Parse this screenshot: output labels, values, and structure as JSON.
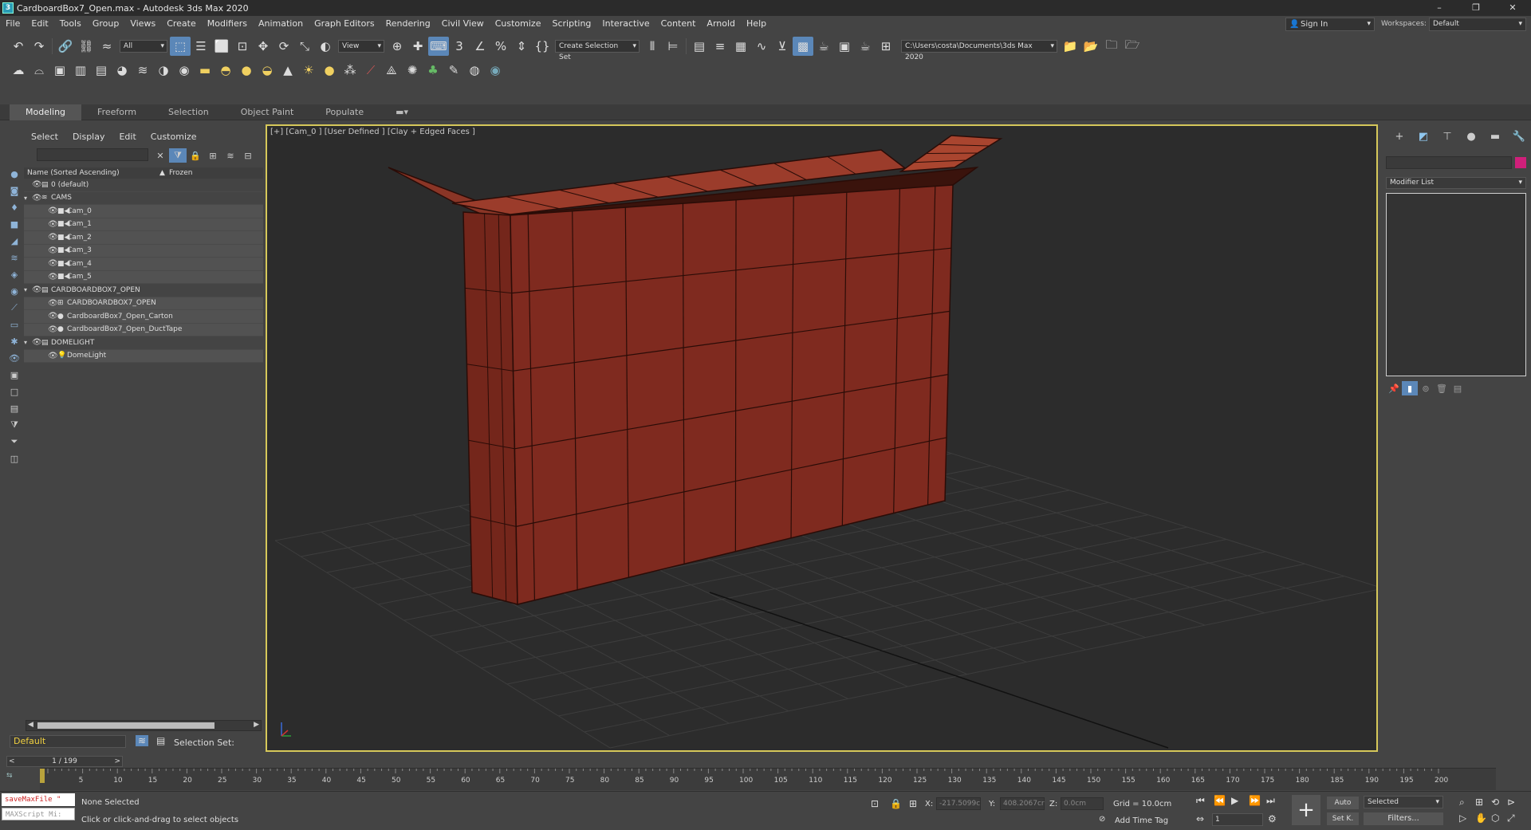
{
  "window": {
    "title": "CardboardBox7_Open.max - Autodesk 3ds Max 2020",
    "icon_letter": "3",
    "minimize": "–",
    "restore": "❐",
    "close": "✕"
  },
  "menu": [
    "File",
    "Edit",
    "Tools",
    "Group",
    "Views",
    "Create",
    "Modifiers",
    "Animation",
    "Graph Editors",
    "Rendering",
    "Civil View",
    "Customize",
    "Scripting",
    "Interactive",
    "Content",
    "Arnold",
    "Help"
  ],
  "account": {
    "sign_in": "Sign In",
    "workspaces_label": "Workspaces:",
    "workspace": "Default"
  },
  "toolbar": {
    "selection_filter": "All",
    "ref_coord": "View",
    "named_selection": "Create Selection Set",
    "project_path": "C:\\Users\\costa\\Documents\\3ds Max 2020"
  },
  "ribbon": {
    "tabs": [
      "Modeling",
      "Freeform",
      "Selection",
      "Object Paint",
      "Populate"
    ]
  },
  "explorer": {
    "menu": [
      "Select",
      "Display",
      "Edit",
      "Customize"
    ],
    "col_name": "Name (Sorted Ascending)",
    "col_sort": "▲",
    "col_frozen": "Frozen",
    "rows": [
      {
        "label": "0 (default)",
        "indent": 0,
        "expander": "",
        "icon": "▤"
      },
      {
        "label": "CAMS",
        "indent": 0,
        "expander": "▾",
        "icon": "≋"
      },
      {
        "label": "Cam_0",
        "indent": 1,
        "expander": "",
        "icon": "■◀"
      },
      {
        "label": "Cam_1",
        "indent": 1,
        "expander": "",
        "icon": "■◀"
      },
      {
        "label": "Cam_2",
        "indent": 1,
        "expander": "",
        "icon": "■◀"
      },
      {
        "label": "Cam_3",
        "indent": 1,
        "expander": "",
        "icon": "■◀"
      },
      {
        "label": "Cam_4",
        "indent": 1,
        "expander": "",
        "icon": "■◀"
      },
      {
        "label": "Cam_5",
        "indent": 1,
        "expander": "",
        "icon": "■◀"
      },
      {
        "label": "CARDBOARDBOX7_OPEN",
        "indent": 0,
        "expander": "▾",
        "icon": "▤"
      },
      {
        "label": "CARDBOARDBOX7_OPEN",
        "indent": 1,
        "expander": "",
        "icon": "⊞"
      },
      {
        "label": "CardboardBox7_Open_Carton",
        "indent": 1,
        "expander": "",
        "icon": "●"
      },
      {
        "label": "CardboardBox7_Open_DuctTape",
        "indent": 1,
        "expander": "",
        "icon": "●"
      },
      {
        "label": "DOMELIGHT",
        "indent": 0,
        "expander": "▾",
        "icon": "▤"
      },
      {
        "label": "DomeLight",
        "indent": 1,
        "expander": "",
        "icon": "💡"
      }
    ],
    "layer": "Default",
    "selection_set_label": "Selection Set:"
  },
  "viewport": {
    "label": "[+] [Cam_0 ] [User Defined ] [Clay + Edged Faces ]",
    "box_color": "#7f2a1f",
    "edge_color": "#2a0c07"
  },
  "command_panel": {
    "modifier_list": "Modifier List",
    "color_swatch": "#d01f7a"
  },
  "timeline": {
    "frame_display": "1 / 199",
    "prev": "<",
    "next": ">",
    "ticks": [
      5,
      10,
      15,
      20,
      25,
      30,
      35,
      40,
      45,
      50,
      55,
      60,
      65,
      70,
      75,
      80,
      85,
      90,
      95,
      100,
      105,
      110,
      115,
      120,
      125,
      130,
      135,
      140,
      145,
      150,
      155,
      160,
      165,
      170,
      175,
      180,
      185,
      190,
      195,
      200
    ]
  },
  "status": {
    "script_line1": "saveMaxFile \"",
    "script_line2": "MAXScript Mi:",
    "selection": "None Selected",
    "prompt": "Click or click-and-drag to select objects",
    "x_label": "X:",
    "x_value": "-217.5099c",
    "y_label": "Y:",
    "y_value": "408.2067cr",
    "z_label": "Z:",
    "z_value": "0.0cm",
    "grid": "Grid = 10.0cm",
    "add_time_tag": "Add Time Tag",
    "frame_value": "1",
    "auto_key": "Auto",
    "set_key": "Set K.",
    "key_filter": "Selected",
    "filters": "Filters..."
  }
}
